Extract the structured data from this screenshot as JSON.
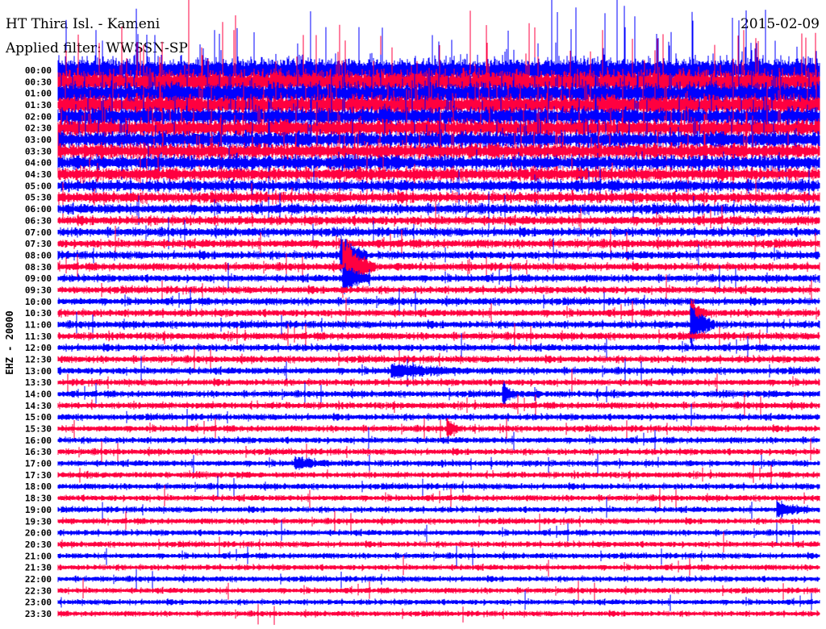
{
  "header": {
    "title": "HT Thira Isl. - Kameni",
    "filter": "Applied filter: WWSSN-SP",
    "date": "2015-02-09"
  },
  "chart_data": {
    "type": "line",
    "title": "HT Thira Isl. - Kameni",
    "subtitle": "Applied filter: WWSSN-SP",
    "date": "2015-02-09",
    "ylabel": "EHZ - 20000",
    "xlabel": "",
    "minutes_per_row": 30,
    "row_labels": [
      "00:00",
      "00:30",
      "01:00",
      "01:30",
      "02:00",
      "02:30",
      "03:00",
      "03:30",
      "04:00",
      "04:30",
      "05:00",
      "05:30",
      "06:00",
      "06:30",
      "07:00",
      "07:30",
      "08:00",
      "08:30",
      "09:00",
      "09:30",
      "10:00",
      "10:30",
      "11:00",
      "11:30",
      "12:00",
      "12:30",
      "13:00",
      "13:30",
      "14:00",
      "14:30",
      "15:00",
      "15:30",
      "16:00",
      "16:30",
      "17:00",
      "17:30",
      "18:00",
      "18:30",
      "19:00",
      "19:30",
      "20:00",
      "20:30",
      "21:00",
      "21:30",
      "22:00",
      "22:30",
      "23:00",
      "23:30"
    ],
    "colors": [
      "#0000ff",
      "#ff0040"
    ],
    "noise_level": [
      14,
      13,
      12,
      11,
      10,
      9.5,
      9,
      8.5,
      8,
      7,
      6.5,
      6,
      5.5,
      5,
      4.8,
      4.6,
      4.4,
      4.2,
      4,
      4,
      4,
      4,
      4,
      4,
      3.8,
      3.8,
      3.8,
      3.6,
      3.6,
      3.6,
      3.5,
      3.5,
      3.4,
      3.4,
      3.4,
      3.3,
      3.3,
      3.3,
      3.2,
      3.2,
      3.2,
      3.2,
      3.1,
      3.1,
      3.1,
      3.1,
      3,
      3
    ],
    "events": [
      {
        "row": "08:00",
        "minute": 11.2,
        "duration": 1.0,
        "amplitude": 30
      },
      {
        "row": "08:30",
        "minute": 11.3,
        "duration": 1.2,
        "amplitude": 40
      },
      {
        "row": "09:00",
        "minute": 11.3,
        "duration": 1.0,
        "amplitude": 20
      },
      {
        "row": "10:30",
        "minute": 25.0,
        "duration": 0.6,
        "amplitude": 18
      },
      {
        "row": "11:00",
        "minute": 25.0,
        "duration": 0.9,
        "amplitude": 30
      },
      {
        "row": "13:00",
        "minute": 13.2,
        "duration": 3.0,
        "amplitude": 9
      },
      {
        "row": "14:00",
        "minute": 17.6,
        "duration": 0.4,
        "amplitude": 14
      },
      {
        "row": "15:30",
        "minute": 15.4,
        "duration": 0.5,
        "amplitude": 12
      },
      {
        "row": "17:00",
        "minute": 9.4,
        "duration": 1.3,
        "amplitude": 8
      },
      {
        "row": "19:00",
        "minute": 28.4,
        "duration": 1.3,
        "amplitude": 9
      }
    ]
  }
}
